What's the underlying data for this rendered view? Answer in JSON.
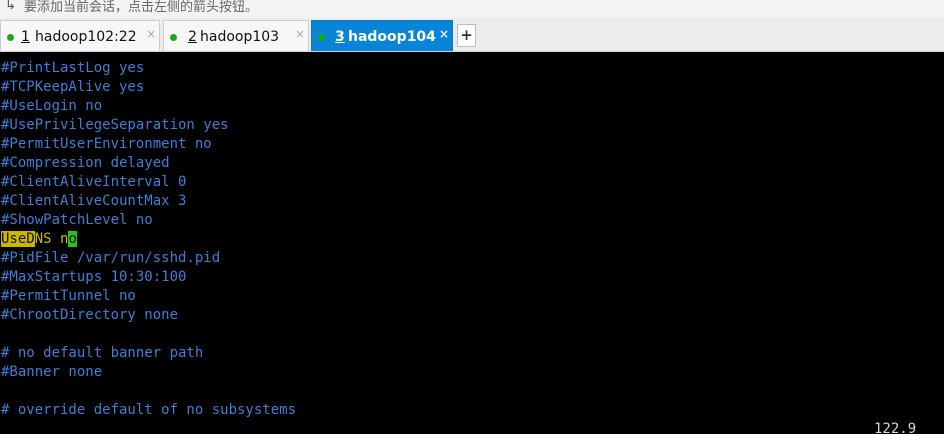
{
  "hint": {
    "text": "要添加当前会话，点击左侧的箭头按钮。",
    "icon": "arrow-back-icon"
  },
  "tabs": [
    {
      "num": "1",
      "label": "hadoop102:22",
      "status_color": "#1aa81a",
      "active": false
    },
    {
      "num": "2",
      "label": "hadoop103",
      "status_color": "#1aa81a",
      "active": false
    },
    {
      "num": "3",
      "label": "hadoop104",
      "status_color": "#1aa81a",
      "active": true
    }
  ],
  "tab_close_glyph": "×",
  "new_tab_label": "+",
  "terminal": {
    "lines": [
      "#PrintLastLog yes",
      "#TCPKeepAlive yes",
      "#UseLogin no",
      "#UsePrivilegeSeparation yes",
      "#PermitUserEnvironment no",
      "#Compression delayed",
      "#ClientAliveInterval 0",
      "#ClientAliveCountMax 3",
      "#ShowPatchLevel no",
      "",
      "#PidFile /var/run/sshd.pid",
      "#MaxStartups 10:30:100",
      "#PermitTunnel no",
      "#ChrootDirectory none",
      "",
      "# no default banner path",
      "#Banner none",
      "",
      "# override default of no subsystems"
    ],
    "usedns": {
      "match": "UseD",
      "rest": "NS n",
      "cursor_char": "o"
    },
    "status_position": "122.9",
    "colors": {
      "comment": "#3d7fd6",
      "search_highlight": "#c9b700",
      "cursor": "#22c51a",
      "background": "#000000"
    }
  }
}
